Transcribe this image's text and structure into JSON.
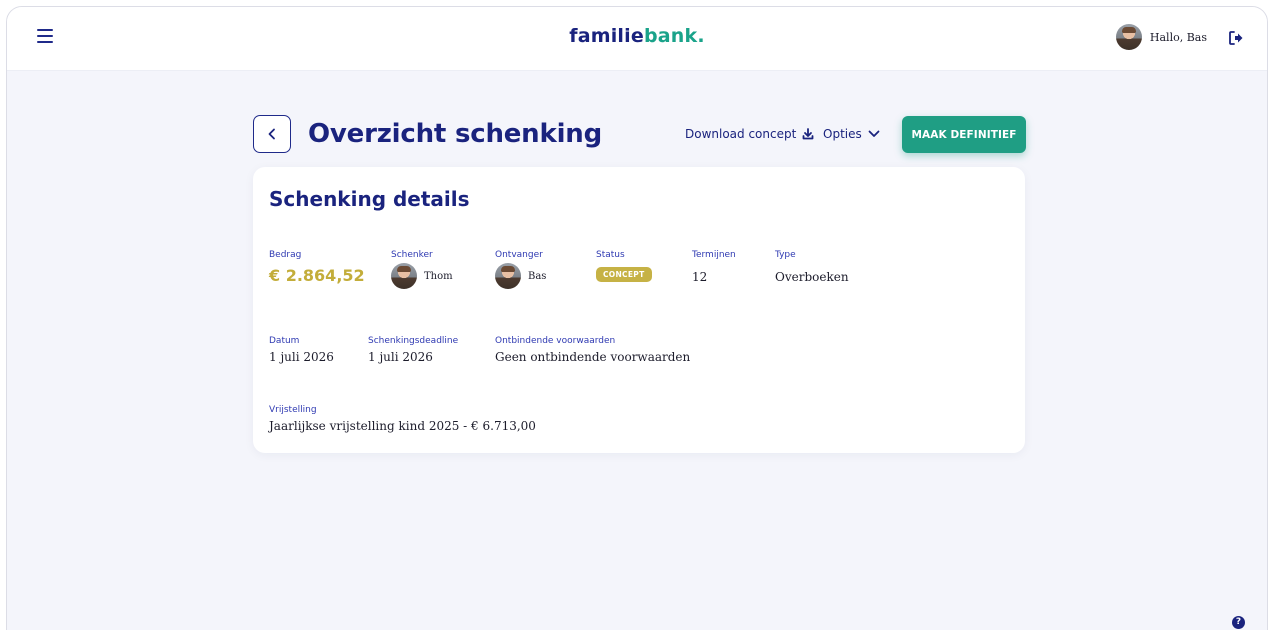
{
  "header": {
    "logo_part1": "familie",
    "logo_part2": "bank",
    "logo_dot": ".",
    "greeting": "Hallo, Bas",
    "menu_icon": "hamburger-icon",
    "logout_icon": "logout-icon"
  },
  "page": {
    "title": "Overzicht schenking",
    "download_label": "Download concept",
    "options_label": "Opties",
    "primary_button": "MAAK DEFINITIEF"
  },
  "details": {
    "title": "Schenking details",
    "amount_label": "Bedrag",
    "amount": "€ 2.864,52",
    "giver_label": "Schenker",
    "giver": "Thom",
    "receiver_label": "Ontvanger",
    "receiver": "Bas",
    "status_label": "Status",
    "status": "CONCEPT",
    "terms_label": "Termijnen",
    "terms": "12",
    "type_label": "Type",
    "type": "Overboeken",
    "date_label": "Datum",
    "date": "1 juli 2026",
    "deadline_label": "Schenkingsdeadline",
    "deadline": "1 juli 2026",
    "conditions_label": "Ontbindende voorwaarden",
    "conditions": "Geen ontbindende voorwaarden",
    "exemption_label": "Vrijstelling",
    "exemption": "Jaarlijkse vrijstelling kind 2025 - € 6.713,00"
  },
  "colors": {
    "primary_navy": "#1a237e",
    "accent_green": "#1f9e84",
    "amount_gold": "#c3ad3a",
    "badge_gold": "#c6b245"
  },
  "help_icon": "help-icon"
}
